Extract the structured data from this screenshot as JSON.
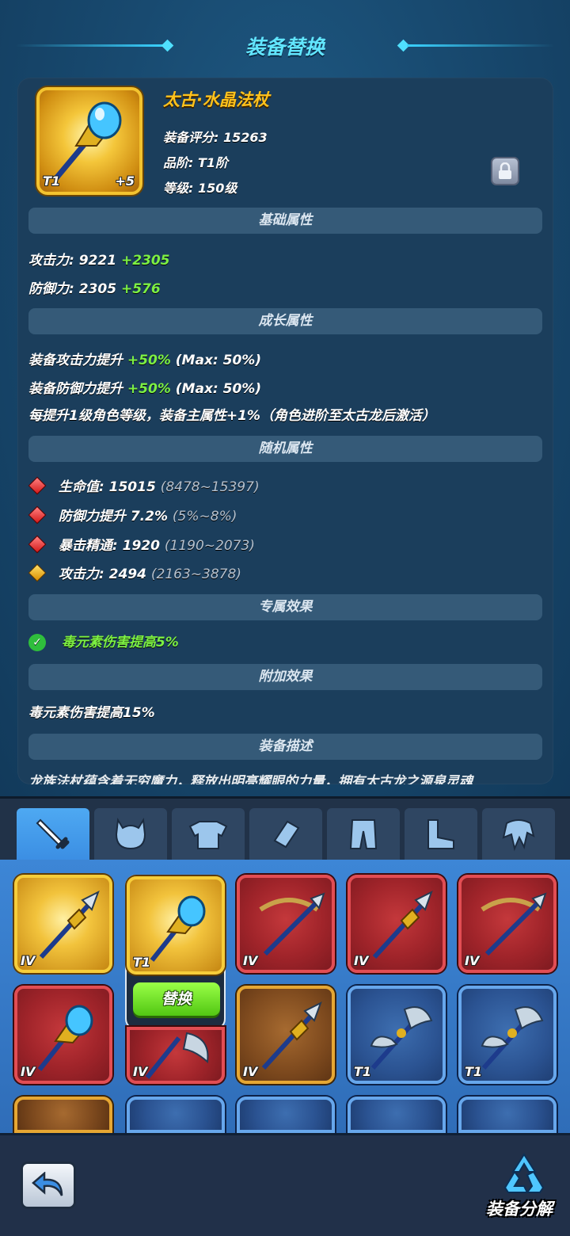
{
  "header": {
    "title": "装备替换"
  },
  "item": {
    "name": "太古·水晶法杖",
    "score_label": "装备评分: 15263",
    "grade_label": "品阶: T1阶",
    "level_label": "等级: 150级",
    "tier": "T1",
    "enhance": "+5"
  },
  "sections": {
    "base": "基础属性",
    "growth": "成长属性",
    "random": "随机属性",
    "exclusive": "专属效果",
    "extra": "附加效果",
    "description": "装备描述"
  },
  "base_stats": [
    {
      "label": "攻击力: 9221",
      "bonus": "+2305"
    },
    {
      "label": "防御力: 2305",
      "bonus": "+576"
    }
  ],
  "growth_stats": [
    {
      "label": "装备攻击力提升",
      "bonus": "+50%",
      "max": "(Max: 50%)"
    },
    {
      "label": "装备防御力提升",
      "bonus": "+50%",
      "max": "(Max: 50%)"
    }
  ],
  "growth_note": "每提升1级角色等级，装备主属性+1%（角色进阶至太古龙后激活）",
  "random_stats": [
    {
      "label": "生命值: 15015",
      "range": "(8478~15397)",
      "gem": "red"
    },
    {
      "label": "防御力提升 7.2%",
      "range": "(5%~8%)",
      "gem": "red"
    },
    {
      "label": "暴击精通: 1920",
      "range": "(1190~2073)",
      "gem": "red"
    },
    {
      "label": "攻击力: 2494",
      "range": "(2163~3878)",
      "gem": "gold"
    }
  ],
  "exclusive_effect": "毒元素伤害提高5%",
  "extra_effect": "毒元素伤害提高15%",
  "description_cut": "龙族法杖蕴含着无穷魔力，释放出明亮耀眼的力量，拥有太古龙之源泉灵魂",
  "tabs": [
    "weapon",
    "helmet",
    "armor",
    "bracer",
    "pants",
    "boots",
    "cloak"
  ],
  "grid": {
    "slots": [
      {
        "tier": "IV",
        "color": "gold",
        "icon": "spear-icon"
      },
      {
        "tier": "T1",
        "color": "gold",
        "icon": "crystal-staff-icon"
      },
      {
        "tier": "IV",
        "color": "red",
        "icon": "crossbow-icon"
      },
      {
        "tier": "IV",
        "color": "red",
        "icon": "spear-icon"
      },
      {
        "tier": "IV",
        "color": "red",
        "icon": "crossbow-icon"
      },
      {
        "tier": "IV",
        "color": "red",
        "icon": "crystal-staff-icon"
      },
      {
        "tier": "IV",
        "color": "red",
        "icon": "axe-icon"
      },
      {
        "tier": "IV",
        "color": "brown",
        "icon": "spear-icon"
      },
      {
        "tier": "T1",
        "color": "blue",
        "icon": "axe-icon"
      },
      {
        "tier": "T1",
        "color": "blue",
        "icon": "axe-icon"
      }
    ],
    "replace_label": "替换"
  },
  "footer": {
    "salvage_label": "装备分解"
  }
}
